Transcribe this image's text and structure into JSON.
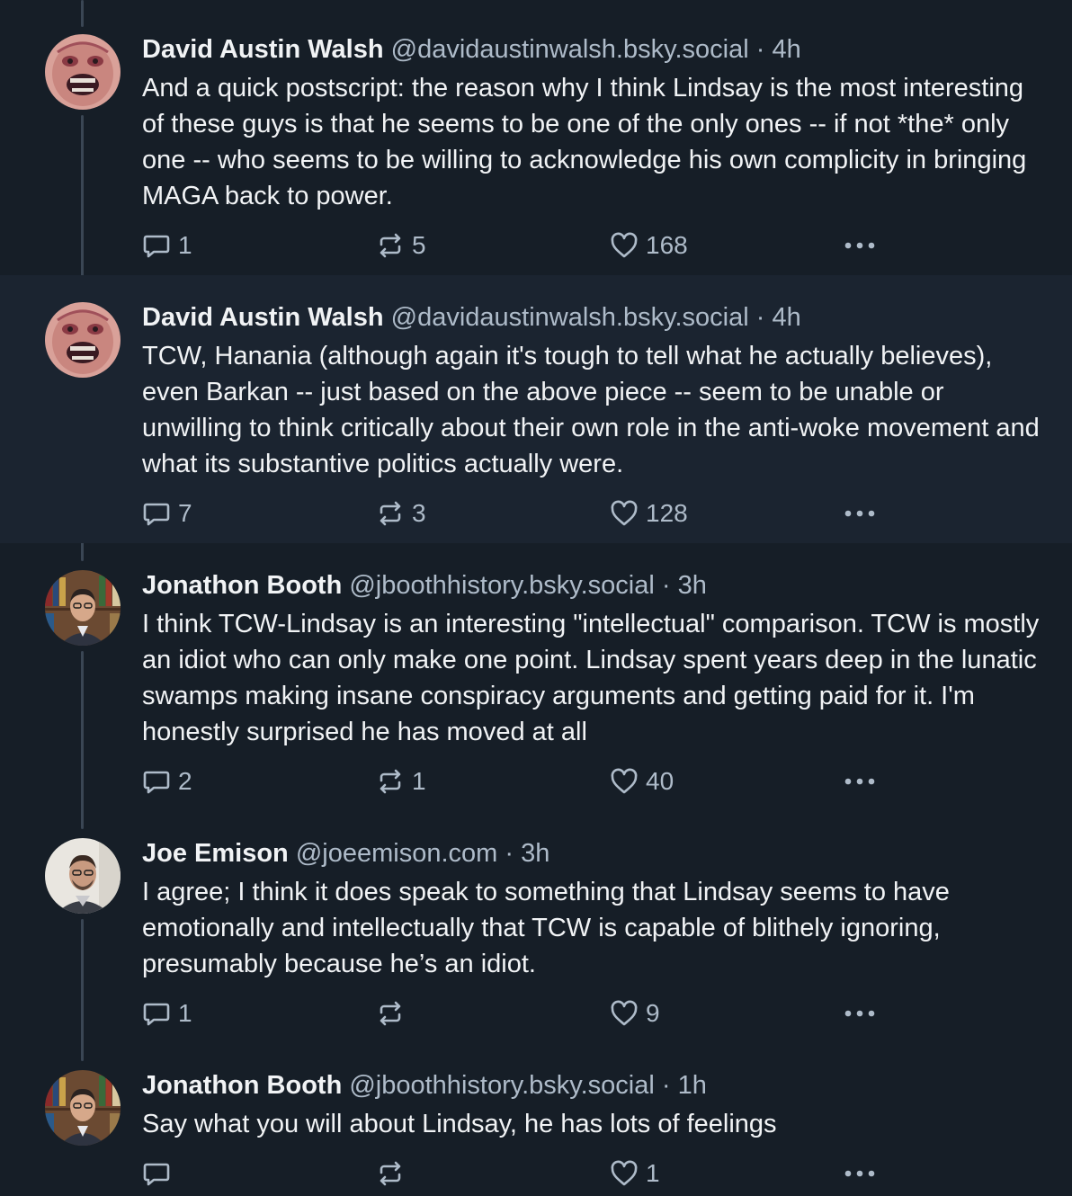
{
  "posts": [
    {
      "author": "David Austin Walsh",
      "handle": "@davidaustinwalsh.bsky.social",
      "separator": "·",
      "time": "4h",
      "text": "And a quick postscript: the reason why I think Lindsay is the most interesting of these guys is that he seems to be one of the only ones -- if not *the* only one -- who seems to be willing to acknowledge his own complicity in bringing MAGA back to power.",
      "replies": "1",
      "reposts": "5",
      "likes": "168",
      "avatar": "album-art-avatar"
    },
    {
      "author": "David Austin Walsh",
      "handle": "@davidaustinwalsh.bsky.social",
      "separator": "·",
      "time": "4h",
      "text": "TCW, Hanania (although again it's tough to tell what he actually believes), even Barkan -- just based on the above piece -- seem to be unable or unwilling to think critically about their own role in the anti-woke movement and what its substantive politics actually were.",
      "replies": "7",
      "reposts": "3",
      "likes": "128",
      "avatar": "album-art-avatar"
    },
    {
      "author": "Jonathon Booth",
      "handle": "@jboothhistory.bsky.social",
      "separator": "·",
      "time": "3h",
      "text": "I think TCW-Lindsay is an interesting \"intellectual\" comparison. TCW is mostly an idiot who can only make one point. Lindsay spent years deep in the lunatic swamps making insane conspiracy arguments and getting paid for it. I'm honestly surprised he has moved at all",
      "replies": "2",
      "reposts": "1",
      "likes": "40",
      "avatar": "bookshelf-portrait-avatar"
    },
    {
      "author": "Joe Emison",
      "handle": "@joeemison.com",
      "separator": "·",
      "time": "3h",
      "text": "I agree; I think it does speak to something that Lindsay seems to have emotionally and intellectually that TCW is capable of blithely ignoring, presumably because he’s an idiot.",
      "replies": "1",
      "reposts": "",
      "likes": "9",
      "avatar": "portrait-avatar"
    },
    {
      "author": "Jonathon Booth",
      "handle": "@jboothhistory.bsky.social",
      "separator": "·",
      "time": "1h",
      "text": "Say what you will about Lindsay, he has lots of feelings",
      "replies": "",
      "reposts": "",
      "likes": "1",
      "avatar": "bookshelf-portrait-avatar"
    }
  ],
  "icons": {
    "reply": "reply-bubble-icon",
    "repost": "repost-arrows-icon",
    "like": "heart-icon",
    "more": "more-dots-icon"
  },
  "colors": {
    "background": "#161e27",
    "highlight_background": "#1b2430",
    "text": "#f1f3f5",
    "muted": "#aebbc9",
    "thread_line": "#3a4654"
  }
}
